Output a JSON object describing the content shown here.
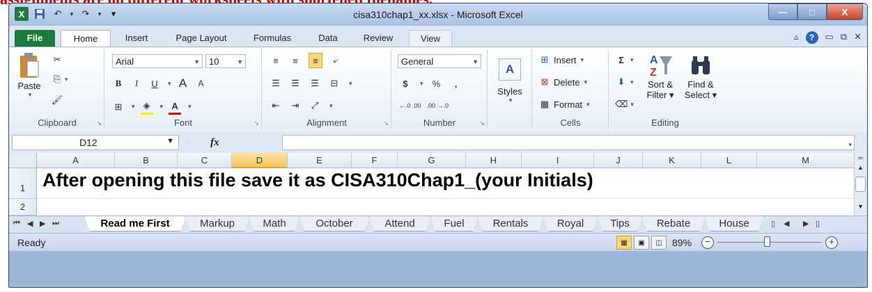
{
  "banner": "assignments are on different worksheets with shortened filenames.",
  "window": {
    "title": "cisa310chap1_xx.xlsx - Microsoft Excel",
    "controls": {
      "minimize": "—",
      "maximize": "□",
      "close": "X"
    }
  },
  "qat": {
    "logo": "X",
    "save": "💾",
    "undo": "↶",
    "redo": "↷",
    "customize": "▾"
  },
  "tabs": [
    "File",
    "Home",
    "Insert",
    "Page Layout",
    "Formulas",
    "Data",
    "Review",
    "View"
  ],
  "active_tab": "Home",
  "ribbon": {
    "clipboard": {
      "label": "Clipboard",
      "paste": "Paste"
    },
    "font": {
      "label": "Font",
      "name": "Arial",
      "size": "10",
      "bold": "B",
      "italic": "I",
      "underline": "U",
      "grow": "A",
      "shrink": "A",
      "fill": "◈",
      "color": "A"
    },
    "alignment": {
      "label": "Alignment"
    },
    "number": {
      "label": "Number",
      "format": "General",
      "currency": "$",
      "percent": "%",
      "comma": ",",
      "inc": "←.0 .00",
      "dec": ".00 →.0"
    },
    "styles": {
      "label": "Styles"
    },
    "cells": {
      "label": "Cells",
      "insert": "Insert",
      "delete": "Delete",
      "format": "Format"
    },
    "editing": {
      "label": "Editing",
      "sum": "Σ",
      "sort": "Sort &",
      "sort2": "Filter",
      "find": "Find &",
      "find2": "Select"
    }
  },
  "formula_bar": {
    "name_box": "D12",
    "fx": "fx",
    "value": ""
  },
  "columns": [
    "A",
    "B",
    "C",
    "D",
    "E",
    "F",
    "G",
    "H",
    "I",
    "J",
    "K",
    "L",
    "M"
  ],
  "selected_column": "D",
  "rows": [
    "1",
    "2"
  ],
  "cell_A1": "After opening this file save it as CISA310Chap1_(your Initials)",
  "sheets": [
    "Read me First",
    "Markup",
    "Math",
    "October",
    "Attend",
    "Fuel",
    "Rentals",
    "Royal",
    "Tips",
    "Rebate",
    "House"
  ],
  "active_sheet": "Read me First",
  "status": {
    "mode": "Ready",
    "zoom": "89%",
    "zoom_fraction": 0.89
  },
  "colors": {
    "file_tab": "#1e7b3c",
    "selection": "#f6c75a",
    "window_frame": "#9eb7d8"
  }
}
